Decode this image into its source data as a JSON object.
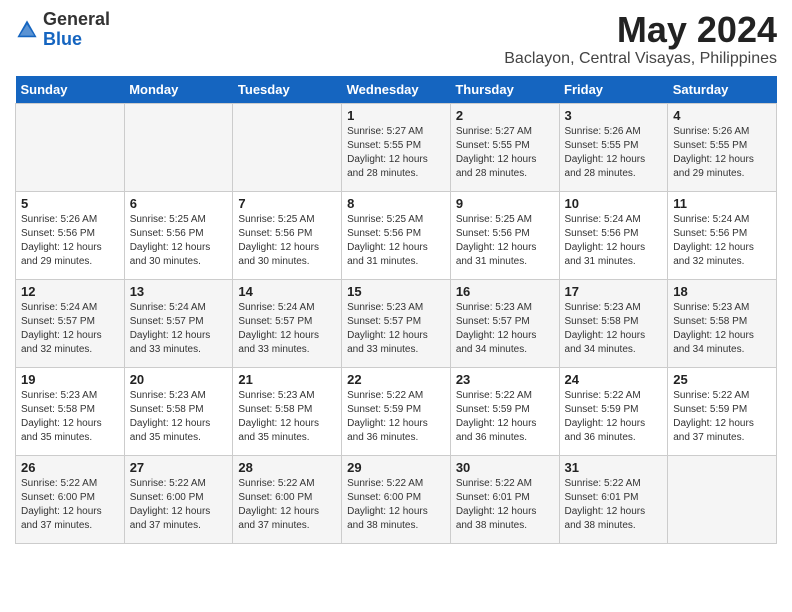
{
  "header": {
    "logo_general": "General",
    "logo_blue": "Blue",
    "month": "May 2024",
    "location": "Baclayon, Central Visayas, Philippines"
  },
  "days_of_week": [
    "Sunday",
    "Monday",
    "Tuesday",
    "Wednesday",
    "Thursday",
    "Friday",
    "Saturday"
  ],
  "weeks": [
    [
      {
        "day": "",
        "info": ""
      },
      {
        "day": "",
        "info": ""
      },
      {
        "day": "",
        "info": ""
      },
      {
        "day": "1",
        "info": "Sunrise: 5:27 AM\nSunset: 5:55 PM\nDaylight: 12 hours\nand 28 minutes."
      },
      {
        "day": "2",
        "info": "Sunrise: 5:27 AM\nSunset: 5:55 PM\nDaylight: 12 hours\nand 28 minutes."
      },
      {
        "day": "3",
        "info": "Sunrise: 5:26 AM\nSunset: 5:55 PM\nDaylight: 12 hours\nand 28 minutes."
      },
      {
        "day": "4",
        "info": "Sunrise: 5:26 AM\nSunset: 5:55 PM\nDaylight: 12 hours\nand 29 minutes."
      }
    ],
    [
      {
        "day": "5",
        "info": "Sunrise: 5:26 AM\nSunset: 5:56 PM\nDaylight: 12 hours\nand 29 minutes."
      },
      {
        "day": "6",
        "info": "Sunrise: 5:25 AM\nSunset: 5:56 PM\nDaylight: 12 hours\nand 30 minutes."
      },
      {
        "day": "7",
        "info": "Sunrise: 5:25 AM\nSunset: 5:56 PM\nDaylight: 12 hours\nand 30 minutes."
      },
      {
        "day": "8",
        "info": "Sunrise: 5:25 AM\nSunset: 5:56 PM\nDaylight: 12 hours\nand 31 minutes."
      },
      {
        "day": "9",
        "info": "Sunrise: 5:25 AM\nSunset: 5:56 PM\nDaylight: 12 hours\nand 31 minutes."
      },
      {
        "day": "10",
        "info": "Sunrise: 5:24 AM\nSunset: 5:56 PM\nDaylight: 12 hours\nand 31 minutes."
      },
      {
        "day": "11",
        "info": "Sunrise: 5:24 AM\nSunset: 5:56 PM\nDaylight: 12 hours\nand 32 minutes."
      }
    ],
    [
      {
        "day": "12",
        "info": "Sunrise: 5:24 AM\nSunset: 5:57 PM\nDaylight: 12 hours\nand 32 minutes."
      },
      {
        "day": "13",
        "info": "Sunrise: 5:24 AM\nSunset: 5:57 PM\nDaylight: 12 hours\nand 33 minutes."
      },
      {
        "day": "14",
        "info": "Sunrise: 5:24 AM\nSunset: 5:57 PM\nDaylight: 12 hours\nand 33 minutes."
      },
      {
        "day": "15",
        "info": "Sunrise: 5:23 AM\nSunset: 5:57 PM\nDaylight: 12 hours\nand 33 minutes."
      },
      {
        "day": "16",
        "info": "Sunrise: 5:23 AM\nSunset: 5:57 PM\nDaylight: 12 hours\nand 34 minutes."
      },
      {
        "day": "17",
        "info": "Sunrise: 5:23 AM\nSunset: 5:58 PM\nDaylight: 12 hours\nand 34 minutes."
      },
      {
        "day": "18",
        "info": "Sunrise: 5:23 AM\nSunset: 5:58 PM\nDaylight: 12 hours\nand 34 minutes."
      }
    ],
    [
      {
        "day": "19",
        "info": "Sunrise: 5:23 AM\nSunset: 5:58 PM\nDaylight: 12 hours\nand 35 minutes."
      },
      {
        "day": "20",
        "info": "Sunrise: 5:23 AM\nSunset: 5:58 PM\nDaylight: 12 hours\nand 35 minutes."
      },
      {
        "day": "21",
        "info": "Sunrise: 5:23 AM\nSunset: 5:58 PM\nDaylight: 12 hours\nand 35 minutes."
      },
      {
        "day": "22",
        "info": "Sunrise: 5:22 AM\nSunset: 5:59 PM\nDaylight: 12 hours\nand 36 minutes."
      },
      {
        "day": "23",
        "info": "Sunrise: 5:22 AM\nSunset: 5:59 PM\nDaylight: 12 hours\nand 36 minutes."
      },
      {
        "day": "24",
        "info": "Sunrise: 5:22 AM\nSunset: 5:59 PM\nDaylight: 12 hours\nand 36 minutes."
      },
      {
        "day": "25",
        "info": "Sunrise: 5:22 AM\nSunset: 5:59 PM\nDaylight: 12 hours\nand 37 minutes."
      }
    ],
    [
      {
        "day": "26",
        "info": "Sunrise: 5:22 AM\nSunset: 6:00 PM\nDaylight: 12 hours\nand 37 minutes."
      },
      {
        "day": "27",
        "info": "Sunrise: 5:22 AM\nSunset: 6:00 PM\nDaylight: 12 hours\nand 37 minutes."
      },
      {
        "day": "28",
        "info": "Sunrise: 5:22 AM\nSunset: 6:00 PM\nDaylight: 12 hours\nand 37 minutes."
      },
      {
        "day": "29",
        "info": "Sunrise: 5:22 AM\nSunset: 6:00 PM\nDaylight: 12 hours\nand 38 minutes."
      },
      {
        "day": "30",
        "info": "Sunrise: 5:22 AM\nSunset: 6:01 PM\nDaylight: 12 hours\nand 38 minutes."
      },
      {
        "day": "31",
        "info": "Sunrise: 5:22 AM\nSunset: 6:01 PM\nDaylight: 12 hours\nand 38 minutes."
      },
      {
        "day": "",
        "info": ""
      }
    ]
  ]
}
